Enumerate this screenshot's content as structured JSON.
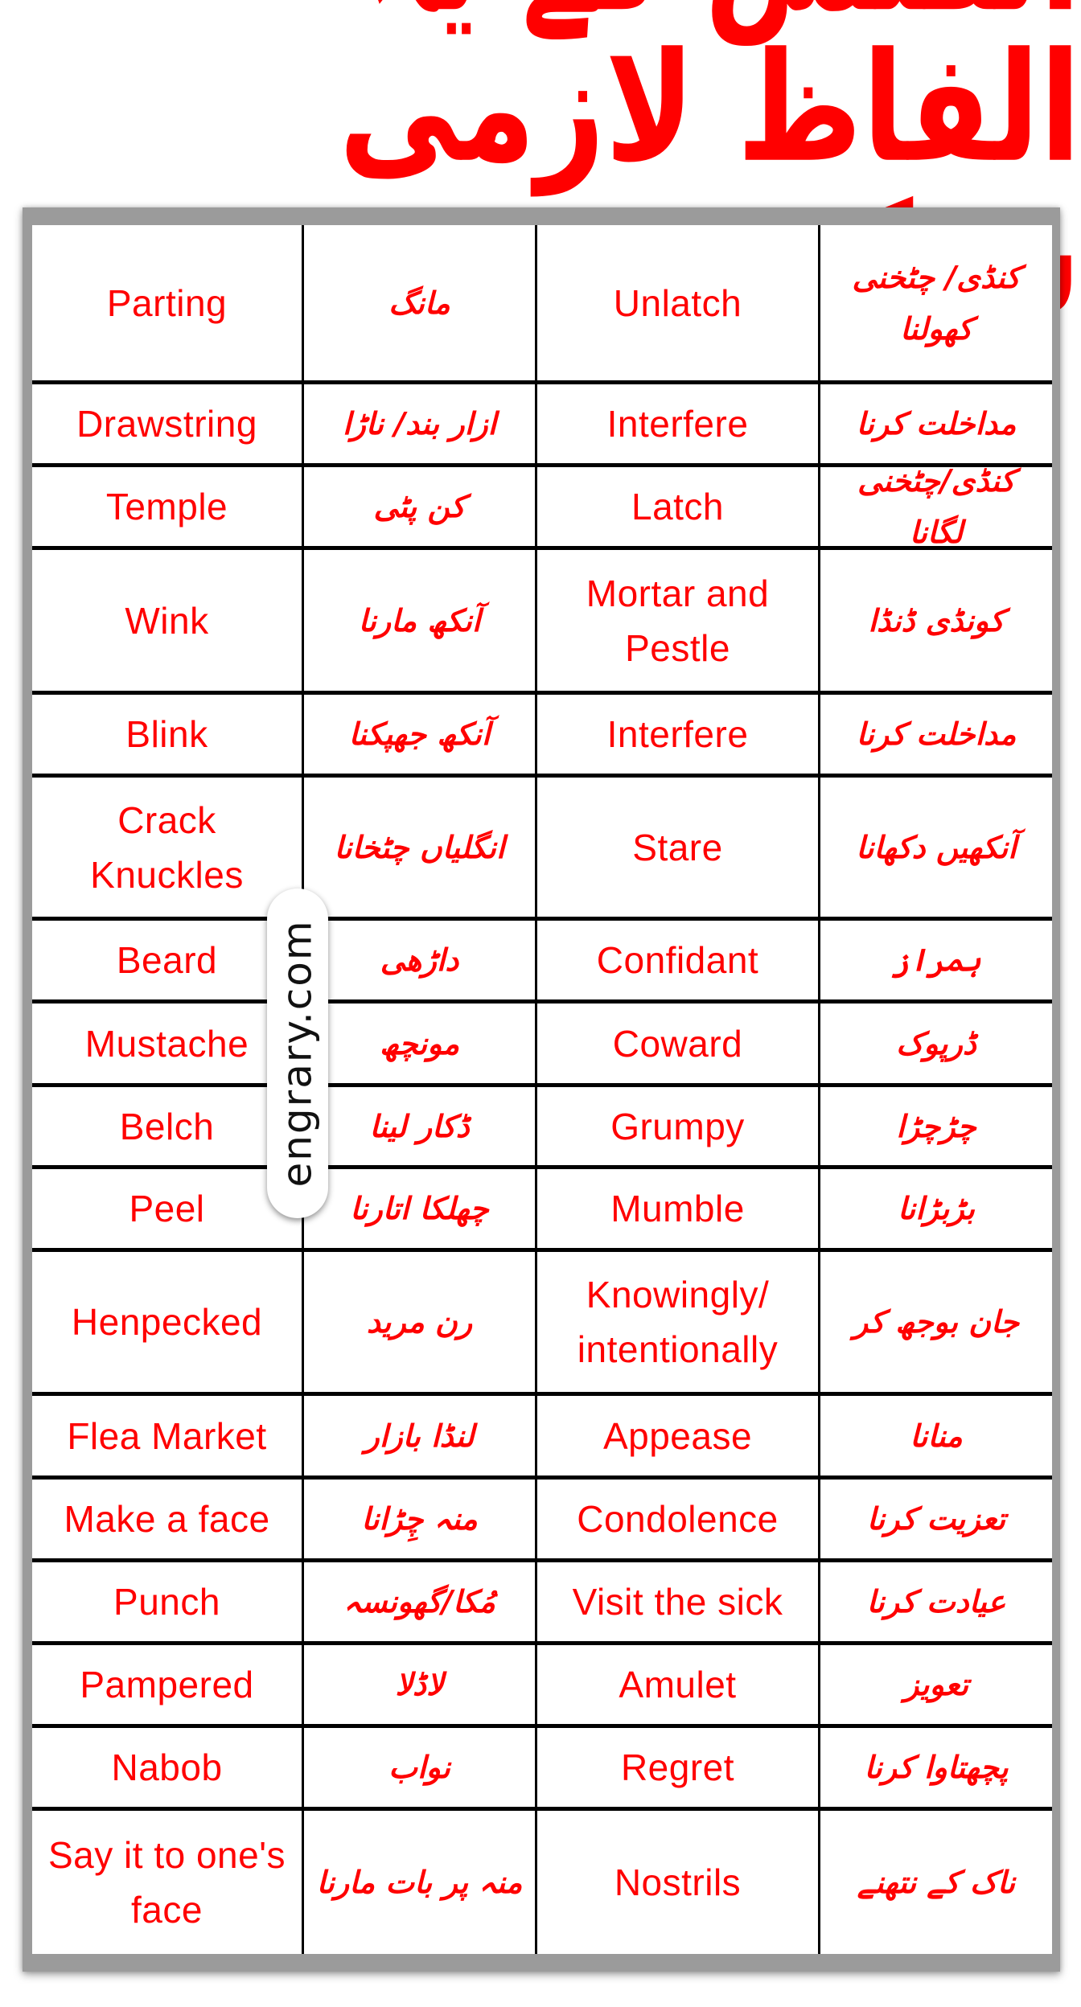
{
  "title": "انگلش کے یہ الفاظ لازمی سیکھیں",
  "watermark": "engrary.com",
  "colors": {
    "text": "#ff0000",
    "frame": "#9b9b9b",
    "grid": "#000000"
  },
  "rows": [
    {
      "en1": "Parting",
      "ur1": "مانگ",
      "en2": "Unlatch",
      "ur2": "کنڈی/ چٹخنی کھولنا"
    },
    {
      "en1": "Drawstring",
      "ur1": "ازار بند/ ناڑا",
      "en2": "Interfere",
      "ur2": "مداخلت کرنا"
    },
    {
      "en1": "Temple",
      "ur1": "کن پٹی",
      "en2": "Latch",
      "ur2": "کنڈی/چٹخنی لگانا"
    },
    {
      "en1": "Wink",
      "ur1": "آنکھ مارنا",
      "en2": "Mortar and Pestle",
      "ur2": "کونڈی ڈنڈا"
    },
    {
      "en1": "Blink",
      "ur1": "آنکھ جھپکنا",
      "en2": "Interfere",
      "ur2": "مداخلت کرنا"
    },
    {
      "en1": "Crack Knuckles",
      "ur1": "انگلیاں چٹخانا",
      "en2": "Stare",
      "ur2": "آنکھیں دکھانا"
    },
    {
      "en1": "Beard",
      "ur1": "داڑھی",
      "en2": "Confidant",
      "ur2": "ہمراز"
    },
    {
      "en1": "Mustache",
      "ur1": "مونچھ",
      "en2": "Coward",
      "ur2": "ڈرپوک"
    },
    {
      "en1": "Belch",
      "ur1": "ڈکار لینا",
      "en2": "Grumpy",
      "ur2": "چڑچڑا"
    },
    {
      "en1": "Peel",
      "ur1": "چھلکا اتارنا",
      "en2": "Mumble",
      "ur2": "بڑبڑانا"
    },
    {
      "en1": "Henpecked",
      "ur1": "رن مرید",
      "en2": "Knowingly/ intentionally",
      "ur2": "جان بوجھ کر"
    },
    {
      "en1": "Flea Market",
      "ur1": "لنڈا بازار",
      "en2": "Appease",
      "ur2": "منانا"
    },
    {
      "en1": "Make a face",
      "ur1": "منہ چِڑانا",
      "en2": "Condolence",
      "ur2": "تعزیت کرنا"
    },
    {
      "en1": "Punch",
      "ur1": "مُکا/گھونسہ",
      "en2": "Visit the sick",
      "ur2": "عیادت کرنا"
    },
    {
      "en1": "Pampered",
      "ur1": "لاڈلا",
      "en2": "Amulet",
      "ur2": "تعویز"
    },
    {
      "en1": "Nabob",
      "ur1": "نواب",
      "en2": "Regret",
      "ur2": "پچھتاوا کرنا"
    },
    {
      "en1": "Say it to one's face",
      "ur1": "منہ پر بات مارنا",
      "en2": "Nostrils",
      "ur2": "ناک کے نتھنے"
    }
  ]
}
